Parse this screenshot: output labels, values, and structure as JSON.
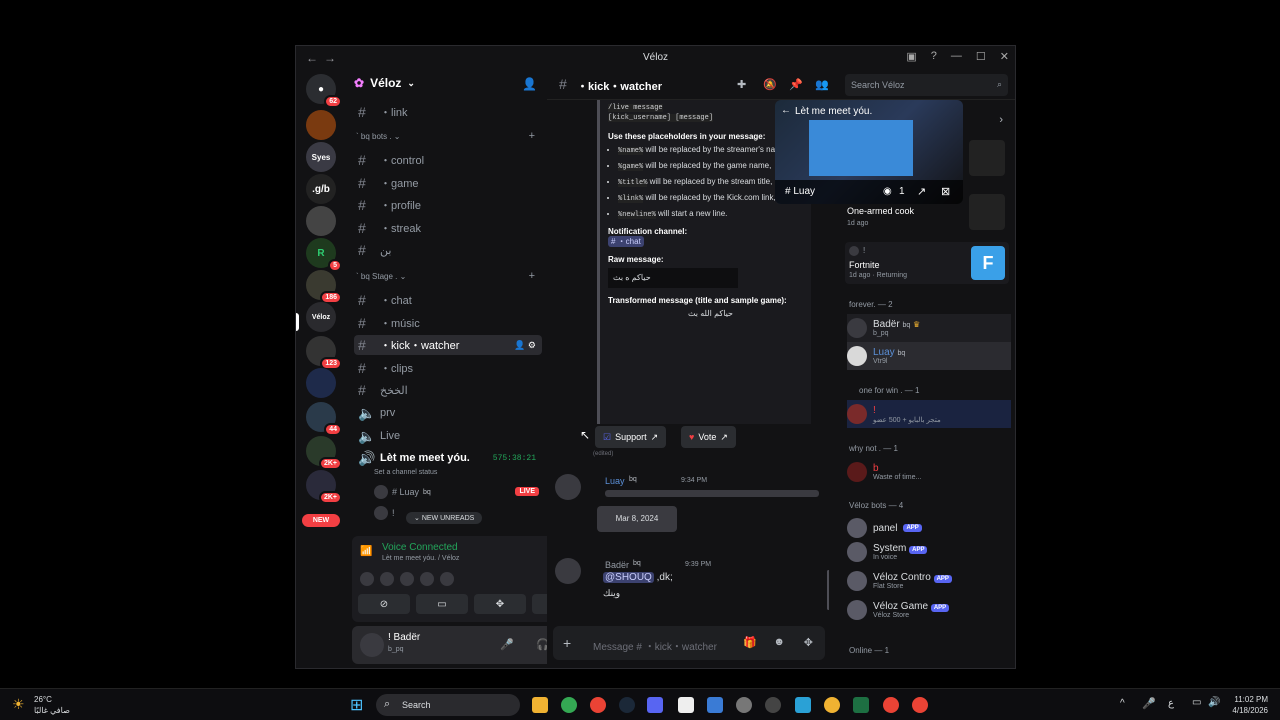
{
  "window": {
    "title": "Véloz",
    "help": "?"
  },
  "rail": {
    "home_badge": "62",
    "servers": [
      {
        "label": "",
        "badge": ""
      },
      {
        "label": "Syes",
        "badge": ""
      },
      {
        "label": ".g/b",
        "badge": ""
      },
      {
        "label": "",
        "badge": ""
      },
      {
        "label": "R",
        "badge": "5"
      },
      {
        "label": "",
        "badge": "186"
      },
      {
        "label": "Véloz",
        "badge": ""
      },
      {
        "label": "",
        "badge": "123"
      },
      {
        "label": "",
        "badge": ""
      },
      {
        "label": "",
        "badge": "44"
      },
      {
        "label": "",
        "badge": "2K+"
      },
      {
        "label": "",
        "badge": "2K+"
      }
    ],
    "new_label": "NEW"
  },
  "sidebar": {
    "guild_name": "Véloz",
    "channels_top": [
      {
        "label": "・link"
      }
    ],
    "cat1": "` bq bots . ⌄",
    "cat1_channels": [
      {
        "label": "・control"
      },
      {
        "label": "・game"
      },
      {
        "label": "・profile"
      },
      {
        "label": "・streak"
      },
      {
        "label": "بن"
      }
    ],
    "cat2": "` bq Stage . ⌄",
    "cat2_channels": [
      {
        "label": "・chat"
      },
      {
        "label": "・músic"
      },
      {
        "label": "・kick・watcher"
      },
      {
        "label": "・clips"
      },
      {
        "label": "الخخخ"
      },
      {
        "label": "prv"
      },
      {
        "label": "Live"
      }
    ],
    "voice_channel": "Lèt me meet yóu.",
    "voice_time": "575:38:21",
    "voice_status": "Set a channel status",
    "voice_user": "# Luay",
    "voice_user_tag": "bq",
    "live": "LIVE",
    "voice_user2": "!",
    "new_unreads": "NEW UNREADS",
    "vc_title": "Voice Connected",
    "vc_sub": "Lèt me meet yóu. / Véloz",
    "user_name": "! Badër",
    "user_status": "b_pq"
  },
  "header": {
    "channel": "・kick・watcher",
    "search_placeholder": "Search Véloz"
  },
  "embed": {
    "cmd1": "/live message",
    "cmd2": "[kick_username] [message]",
    "placeholders_title": "Use these placeholders in your message:",
    "p1_code": "%name%",
    "p1": " will be replaced by the streamer's name,",
    "p2_code": "%game%",
    "p2": " will be replaced by the game name,",
    "p3_code": "%title%",
    "p3": " will be replaced by the stream title,",
    "p4_code": "%link%",
    "p4": " will be replaced by the Kick.com link,",
    "p5_code": "%newline%",
    "p5": " will start a new line.",
    "notif_title": "Notification channel:",
    "notif_channel": "# ・chat",
    "raw_title": "Raw message:",
    "raw_value": "حياكم ه بث",
    "transformed_title": "Transformed message (title and sample game):",
    "transformed_value": "حياكم الله بث",
    "support": "Support",
    "vote": "Vote",
    "edited": "(edited)"
  },
  "messages": [
    {
      "author": "Luay",
      "tag": "bq",
      "time": "9:34 PM"
    },
    {
      "date_label": "Mar 8, 2024"
    },
    {
      "author": "Badër",
      "tag": "bq",
      "time": "9:39 PM",
      "mention": "@SHOUQ",
      "text": " ,dk;",
      "text2": "وينك"
    }
  ],
  "composer_placeholder": "Message # ・kick・watcher",
  "pip": {
    "title": "Lèt me meet yóu.",
    "channel": "# Luay",
    "viewers": "1"
  },
  "members": {
    "activity1_title": "One-armed cook",
    "activity1_time": "1d ago",
    "activity2_user": "!",
    "activity2_title": "Fortnite",
    "activity2_time": "1d ago · Returning",
    "grp_forever": "forever. — 2",
    "m1_name": "Badër",
    "m1_tag": "bq",
    "m1_sub": "b_pq",
    "m2_name": "Luay",
    "m2_tag": "bq",
    "m2_sub": "Vtr9l",
    "grp_onewin": "one for win . — 1",
    "m3_name": "!",
    "m3_sub": "متجر بالبايو + 500 عضو",
    "grp_whynot": "why not . — 1",
    "m4_name": "b",
    "m4_sub": "Waste of time...",
    "grp_bots": "Véloz bots — 4",
    "bots": [
      {
        "name": "panel",
        "sub": ""
      },
      {
        "name": "System",
        "sub": "In voice"
      },
      {
        "name": "Véloz Contro",
        "sub": "Flat Store"
      },
      {
        "name": "Véloz Game",
        "sub": "Véloz Store"
      }
    ],
    "app_label": "APP",
    "grp_online": "Online — 1"
  },
  "taskbar": {
    "temp": "26°C",
    "weather": "صافي غالبًا",
    "search": "Search",
    "time": "11:02 PM",
    "date": "4/18/2026",
    "lang": "ع"
  },
  "colors": {
    "accent": "#5865f2",
    "danger": "#f23f43",
    "online": "#23a55a",
    "bg": "#121214"
  }
}
